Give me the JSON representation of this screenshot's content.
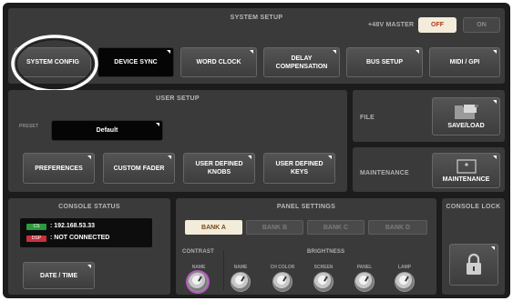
{
  "system_setup": {
    "title": "SYSTEM SETUP",
    "phantom_label": "+48V MASTER",
    "off_label": "OFF",
    "on_label": "ON",
    "buttons": [
      {
        "label": "SYSTEM CONFIG"
      },
      {
        "label": "DEVICE SYNC"
      },
      {
        "label": "WORD CLOCK"
      },
      {
        "label": "DELAY\nCOMPENSATION"
      },
      {
        "label": "BUS SETUP"
      },
      {
        "label": "MIDI / GPI"
      }
    ]
  },
  "user_setup": {
    "title": "USER SETUP",
    "preset_label": "PRESET",
    "preset_value": "Default",
    "buttons": [
      {
        "label": "PREFERENCES"
      },
      {
        "label": "CUSTOM FADER"
      },
      {
        "label": "USER DEFINED\nKNOBS"
      },
      {
        "label": "USER DEFINED\nKEYS"
      }
    ]
  },
  "file": {
    "title": "FILE",
    "button_label": "SAVE/LOAD"
  },
  "maintenance": {
    "title": "MAINTENANCE",
    "button_label": "MAINTENANCE"
  },
  "console_status": {
    "title": "CONSOLE STATUS",
    "cs_badge": "CS",
    "dsp_badge": "DSP",
    "cs_value": ":  192.168.53.33",
    "dsp_value": ":  NOT CONNECTED",
    "date_time_label": "DATE / TIME"
  },
  "panel_settings": {
    "title": "PANEL SETTINGS",
    "banks": [
      "BANK A",
      "BANK B",
      "BANK C",
      "BANK D"
    ],
    "selected_bank": "BANK A",
    "contrast_label": "CONTRAST",
    "brightness_label": "BRIGHTNESS",
    "knobs": [
      "NAME",
      "NAME",
      "CH COLOR",
      "SCREEN",
      "PANEL",
      "LAMP"
    ]
  },
  "console_lock": {
    "title": "CONSOLE LOCK"
  },
  "colors": {
    "accent_active_bank": "#f3ecda",
    "cs_badge": "#2e9a3d",
    "dsp_badge": "#c8303a",
    "highlight_ring": "#ffffff"
  }
}
